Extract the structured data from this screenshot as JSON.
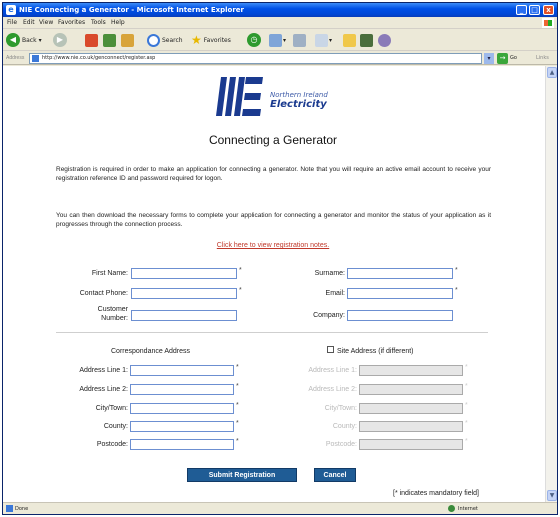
{
  "window": {
    "title": "NIE Connecting a Generator - Microsoft Internet Explorer",
    "minimize": "_",
    "maximize": "□",
    "close": "x"
  },
  "menu": [
    "File",
    "Edit",
    "View",
    "Favorites",
    "Tools",
    "Help"
  ],
  "toolbar": {
    "back": "Back",
    "search": "Search",
    "favorites": "Favorites"
  },
  "address": {
    "label": "Address",
    "url": "http://www.nie.co.uk/genconnect/register.asp",
    "go": "Go",
    "links": "Links"
  },
  "logo": {
    "line1": "Northern Ireland",
    "line2": "Electricity"
  },
  "page": {
    "title": "Connecting a Generator",
    "intro1": "Registration is required in order to make an application for connecting a generator. Note that you will require an active email account to receive your registration reference ID and password required for logon.",
    "intro2": "You can then download the necessary forms to complete your application for connecting a generator and monitor the status of your application as it progresses through the connection process.",
    "notes_link": "Click here to view registration notes."
  },
  "form": {
    "first_name": "First Name:",
    "surname": "Surname:",
    "contact_phone": "Contact Phone:",
    "email": "Email:",
    "customer_number_line1": "Customer",
    "customer_number_line2": "Number:",
    "company": "Company:",
    "asterisk": "*",
    "correspondence_heading": "Correspondance Address",
    "site_address_heading": "Site Address (if different)",
    "address_line_1": "Address Line 1:",
    "address_line_2": "Address Line 2:",
    "city_town": "City/Town:",
    "county": "County:",
    "postcode": "Postcode:"
  },
  "buttons": {
    "submit": "Submit Registration",
    "cancel": "Cancel"
  },
  "mandatory_note": "[* indicates mandatory field]",
  "status": {
    "text": "Done",
    "zone": "Internet"
  },
  "colors": {
    "title_bar": "#0050e6",
    "logo_blue": "#1a3a8f",
    "button_blue": "#1f5c95",
    "link_red": "#c0392b"
  }
}
